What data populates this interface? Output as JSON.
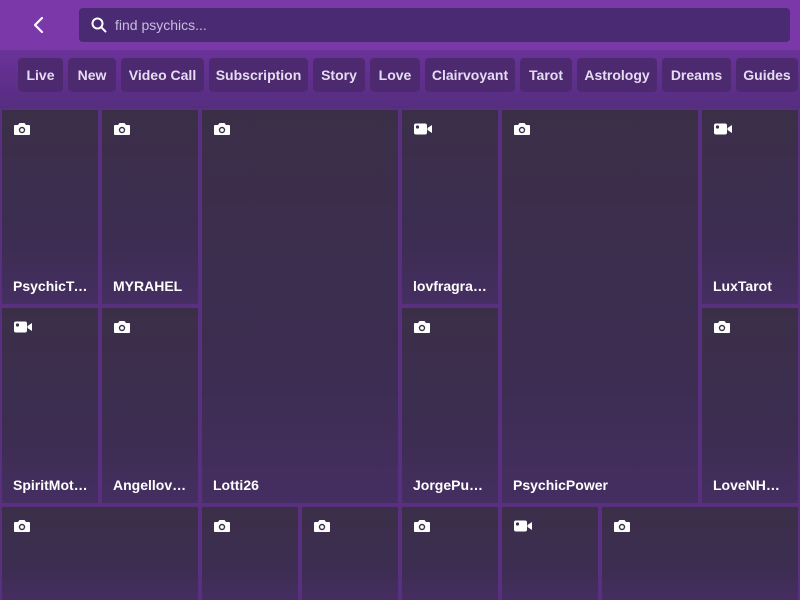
{
  "search": {
    "placeholder": "find psychics..."
  },
  "tabs": [
    "Live",
    "New",
    "Video Call",
    "Subscription",
    "Story",
    "Love",
    "Clairvoyant",
    "Tarot",
    "Astrology",
    "Dreams",
    "Guides"
  ],
  "cards": [
    {
      "name": "PsychicTa...",
      "icon": "camera-icon"
    },
    {
      "name": "MYRAHEL",
      "icon": "camera-icon"
    },
    {
      "name": "Lotti26",
      "icon": "camera-icon"
    },
    {
      "name": "lovfragran...",
      "icon": "video-icon"
    },
    {
      "name": "PsychicPower",
      "icon": "camera-icon"
    },
    {
      "name": "LuxTarot",
      "icon": "video-icon"
    },
    {
      "name": "SpiritMoth...",
      "icon": "video-icon"
    },
    {
      "name": "Angellove...",
      "icon": "camera-icon"
    },
    {
      "name": "JorgePurgly",
      "icon": "camera-icon"
    },
    {
      "name": "LoveNHope",
      "icon": "camera-icon"
    },
    {
      "name": "",
      "icon": "camera-icon"
    },
    {
      "name": "",
      "icon": "camera-icon"
    },
    {
      "name": "",
      "icon": "camera-icon"
    },
    {
      "name": "",
      "icon": "camera-icon"
    },
    {
      "name": "",
      "icon": "video-icon"
    },
    {
      "name": "",
      "icon": "camera-icon"
    }
  ],
  "colors": {
    "topbar": "#7a38a8",
    "tab_bg": "#4d2a70",
    "card_bg": "#3b2f48",
    "accent": "#5a2f8a"
  }
}
